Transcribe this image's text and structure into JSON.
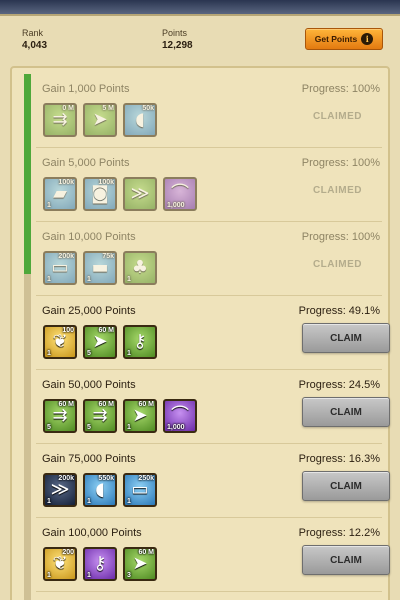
{
  "header": {
    "rank_label": "Rank",
    "rank_value": "4,043",
    "points_label": "Points",
    "points_value": "12,298",
    "get_points_label": "Get Points",
    "info_glyph": "i"
  },
  "overall_progress_fraction": 0.37,
  "claimed_label": "CLAIMED",
  "claim_label": "CLAIM",
  "rows": [
    {
      "title": "Gain 1,000 Points",
      "progress": "Progress: 100%",
      "status": "claimed",
      "rewards": [
        {
          "icon": "speedup-green-icon",
          "glyph": "⇉",
          "color": "green",
          "amount": "0 M",
          "count": ""
        },
        {
          "icon": "speedup-arrows-icon",
          "glyph": "➤",
          "color": "green",
          "amount": "5 M",
          "count": ""
        },
        {
          "icon": "meat-food-icon",
          "glyph": "◖",
          "color": "blue",
          "amount": "50k",
          "count": ""
        }
      ]
    },
    {
      "title": "Gain 5,000 Points",
      "progress": "Progress: 100%",
      "status": "claimed",
      "rewards": [
        {
          "icon": "stone-resource-icon",
          "glyph": "▰",
          "color": "blue",
          "amount": "100k",
          "count": "1"
        },
        {
          "icon": "wood-resource-icon",
          "glyph": "◙",
          "color": "blue",
          "amount": "100k",
          "count": ""
        },
        {
          "icon": "rank-chevron-icon",
          "glyph": "≫",
          "color": "green",
          "amount": "",
          "count": ""
        },
        {
          "icon": "scroll-icon",
          "glyph": "⌒",
          "color": "purple",
          "amount": "",
          "count": "1,000"
        }
      ]
    },
    {
      "title": "Gain 10,000 Points",
      "progress": "Progress: 100%",
      "status": "claimed",
      "rewards": [
        {
          "icon": "iron-ingot-icon",
          "glyph": "▭",
          "color": "blue",
          "amount": "200k",
          "count": "1"
        },
        {
          "icon": "lumber-icon",
          "glyph": "▬",
          "color": "blue",
          "amount": "75k",
          "count": "1"
        },
        {
          "icon": "crops-icon",
          "glyph": "♣",
          "color": "green",
          "amount": "",
          "count": "1"
        }
      ]
    },
    {
      "title": "Gain 25,000 Points",
      "progress": "Progress: 49.1%",
      "status": "claim",
      "rewards": [
        {
          "icon": "gold-coin-icon",
          "glyph": "❦",
          "color": "gold",
          "amount": "100",
          "count": "1"
        },
        {
          "icon": "speedup-arrows-icon",
          "glyph": "➤",
          "color": "green",
          "amount": "60 M",
          "count": "5"
        },
        {
          "icon": "key-icon",
          "glyph": "⚷",
          "color": "green",
          "amount": "",
          "count": "1"
        }
      ]
    },
    {
      "title": "Gain 50,000 Points",
      "progress": "Progress: 24.5%",
      "status": "claim",
      "rewards": [
        {
          "icon": "speedup-green-icon",
          "glyph": "⇉",
          "color": "green",
          "amount": "60 M",
          "count": "5"
        },
        {
          "icon": "speedup-green-icon",
          "glyph": "⇉",
          "color": "green",
          "amount": "60 M",
          "count": "5"
        },
        {
          "icon": "speedup-arrows-icon",
          "glyph": "➤",
          "color": "green",
          "amount": "60 M",
          "count": "1"
        },
        {
          "icon": "scroll-icon",
          "glyph": "⌒",
          "color": "purple",
          "amount": "",
          "count": "1,000"
        }
      ]
    },
    {
      "title": "Gain 75,000 Points",
      "progress": "Progress: 16.3%",
      "status": "claim",
      "rewards": [
        {
          "icon": "rank-chevron-icon",
          "glyph": "≫",
          "color": "dark",
          "amount": "200k",
          "count": "1"
        },
        {
          "icon": "meat-food-icon",
          "glyph": "◖",
          "color": "blue",
          "amount": "550k",
          "count": "1"
        },
        {
          "icon": "iron-ingot-icon",
          "glyph": "▭",
          "color": "blue",
          "amount": "250k",
          "count": "1"
        }
      ]
    },
    {
      "title": "Gain 100,000 Points",
      "progress": "Progress: 12.2%",
      "status": "claim",
      "rewards": [
        {
          "icon": "gold-coin-icon",
          "glyph": "❦",
          "color": "gold",
          "amount": "200",
          "count": "1"
        },
        {
          "icon": "key-icon",
          "glyph": "⚷",
          "color": "purple",
          "amount": "",
          "count": "1"
        },
        {
          "icon": "speedup-arrows-icon",
          "glyph": "➤",
          "color": "green",
          "amount": "60 M",
          "count": "3"
        }
      ]
    }
  ]
}
